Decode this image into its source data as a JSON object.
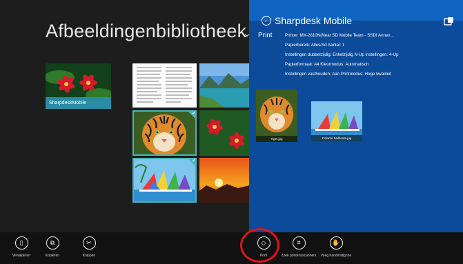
{
  "library": {
    "title": "Afbeeldingenbibliotheek",
    "folder_label": "SharpdeskMobile",
    "check_mark": "✓"
  },
  "panel": {
    "back_icon": "←",
    "title": "Sharpdesk Mobile",
    "print_label": "Print",
    "info": [
      "Printer: MX-2610N(Near SD Mobile Team - SSDI Annex...",
      "Papierbereik: Alles/Ad   Aantal: 1",
      "Instellingen dubbelzijdig: Enkelzijdig   N-Up instellingen: 4-Up",
      "Papierformaat: A4   Kleurmodus: Automatisch",
      "Instellingen vasthouden: Aan   Printmodus: Hoge kwaliteit"
    ],
    "previews": [
      {
        "caption": "Tiger.jpg"
      },
      {
        "caption": "Colorful Sailboats.jpg"
      }
    ],
    "colors": {
      "header": "#1064c1",
      "body": "#0c4a9a"
    }
  },
  "appbar": {
    "left_buttons": [
      {
        "label": "Verwijderen",
        "icon": "trash-icon"
      },
      {
        "label": "Kopiëren",
        "icon": "copy-icon"
      },
      {
        "label": "Knippen",
        "icon": "scissors-icon"
      }
    ],
    "right_buttons": [
      {
        "label": "Print",
        "icon": "print-icon"
      },
      {
        "label": "Zoek printers/scanners",
        "icon": "search-printers-icon"
      },
      {
        "label": "Voeg handmatig toe",
        "icon": "add-manually-icon"
      }
    ],
    "highlight_color": "#e2131a"
  }
}
